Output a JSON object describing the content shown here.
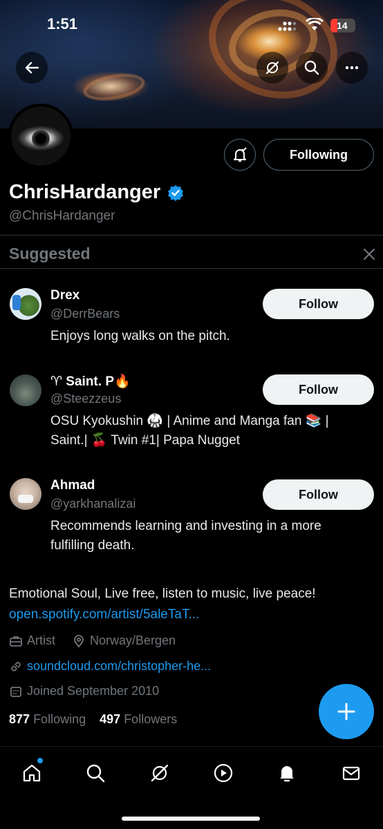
{
  "status_bar": {
    "time": "1:51",
    "battery": "14"
  },
  "profile": {
    "display_name": "ChrisHardanger",
    "handle": "@ChrisHardanger",
    "following_button": "Following",
    "bio": "Emotional Soul, Live free, listen to music, live peace!",
    "bio_link": "open.spotify.com/artist/5aleTaT...",
    "category": "Artist",
    "location": "Norway/Bergen",
    "website": "soundcloud.com/christopher-he...",
    "joined": "Joined September 2010",
    "following_count": "877",
    "following_label": "Following",
    "followers_count": "497",
    "followers_label": "Followers"
  },
  "suggested": {
    "title": "Suggested",
    "items": [
      {
        "name": "Drex",
        "handle": "@DerrBears",
        "bio": "Enjoys long walks on the pitch.",
        "button": "Follow"
      },
      {
        "name": "♈ Saint. P🔥",
        "handle": "@Steezzeus",
        "bio": "OSU Kyokushin 🥋 | Anime and Manga fan 📚 | Saint.| 🍒 Twin #1| Papa Nugget",
        "button": "Follow"
      },
      {
        "name": "Ahmad",
        "handle": "@yarkhanalizai",
        "bio": "Recommends learning and investing in a more fulfilling death.",
        "button": "Follow"
      }
    ]
  },
  "colors": {
    "accent": "#1d9bf0",
    "background": "#000000",
    "muted": "#71767b"
  },
  "tabbar": [
    "home-icon",
    "search-icon",
    "grok-icon",
    "video-icon",
    "notifications-icon",
    "messages-icon"
  ]
}
